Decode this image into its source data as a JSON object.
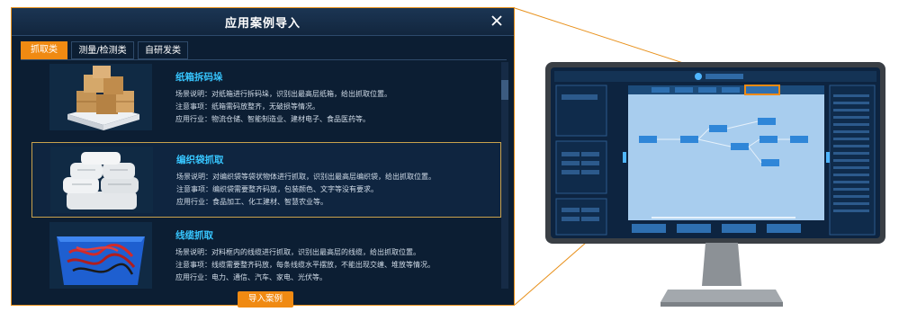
{
  "dialog": {
    "title": "应用案例导入",
    "close_icon": "close-icon",
    "tabs": [
      {
        "label": "抓取类",
        "active": true
      },
      {
        "label": "测量/检测类",
        "active": false
      },
      {
        "label": "自研发类",
        "active": false
      }
    ],
    "items": [
      {
        "title": "纸箱拆码垛",
        "scene": "场景说明：对纸箱进行拆码垛，识别出最高层纸箱，给出抓取位置。",
        "notes": "注意事项：纸箱需码放整齐，无破损等情况。",
        "industry": "应用行业：物流仓储、智能制造业、建材电子、食品医药等。",
        "image": "cardboard-boxes-image",
        "selected": false
      },
      {
        "title": "编织袋抓取",
        "scene": "场景说明：对编织袋等袋状物体进行抓取，识别出最高层编织袋，给出抓取位置。",
        "notes": "注意事项：编织袋需要整齐码放，包装颜色、文字等没有要求。",
        "industry": "应用行业：食品加工、化工建材、智慧农业等。",
        "image": "woven-bags-image",
        "selected": true
      },
      {
        "title": "线缆抓取",
        "scene": "场景说明：对料框内的线缆进行抓取，识别出最高层的线缆，给出抓取位置。",
        "notes": "注意事项：线缆需要整齐码放，每条线缆水平摆放，不能出现交缠、堆放等情况。",
        "industry": "应用行业：电力、通信、汽车、家电、光伏等。",
        "image": "cable-bin-image",
        "selected": false
      }
    ],
    "import_button": "导入案例"
  },
  "colors": {
    "accent": "#f08a12",
    "dialog_bg": "#0c1e33",
    "title_cyan": "#37c6ff",
    "callout_line": "#e8911c"
  },
  "monitor": {
    "description_icon": "monitor-illustration",
    "highlight": "import-case-tab-highlight"
  }
}
